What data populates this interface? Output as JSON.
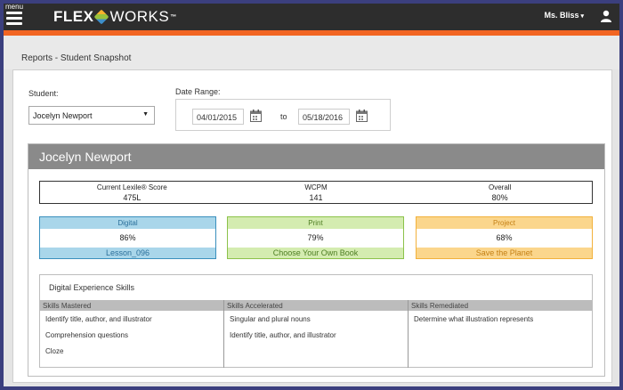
{
  "nav": {
    "menu_label": "menu",
    "logo_flex": "FLEX",
    "logo_works": "WORKS",
    "logo_tm": "™",
    "user_name": "Ms. Bliss"
  },
  "breadcrumb": "Reports - Student Snapshot",
  "filters": {
    "student_label": "Student:",
    "student_value": "Jocelyn Newport",
    "date_range_label": "Date Range:",
    "date_from": "04/01/2015",
    "date_to": "05/18/2016",
    "to_label": "to"
  },
  "snapshot": {
    "student_name": "Jocelyn Newport",
    "scores": [
      {
        "label": "Current Lexile® Score",
        "value": "475L"
      },
      {
        "label": "WCPM",
        "value": "141"
      },
      {
        "label": "Overall",
        "value": "80%"
      }
    ],
    "metrics": {
      "digital": {
        "label": "Digital",
        "value": "86%",
        "item": "Lesson_096"
      },
      "print": {
        "label": "Print",
        "value": "79%",
        "item": "Choose Your Own Book"
      },
      "project": {
        "label": "Project",
        "value": "68%",
        "item": "Save the Planet"
      }
    },
    "skills": {
      "title": "Digital Experience Skills",
      "mastered": {
        "header": "Skills Mastered",
        "items": [
          "Identify title, author, and illustrator",
          "Comprehension questions",
          "Cloze"
        ]
      },
      "accelerated": {
        "header": "Skills Accelerated",
        "items": [
          "Singular and plural nouns",
          "Identify title, author, and illustrator"
        ]
      },
      "remediated": {
        "header": "Skills Remediated",
        "items": [
          "Determine what illustration represents"
        ]
      }
    }
  },
  "colors": {
    "nav_bg": "#2d2d2d",
    "accent_orange": "#f26522",
    "digital": "#3a8fbd",
    "print": "#8cc24a",
    "project": "#f2b13b"
  }
}
